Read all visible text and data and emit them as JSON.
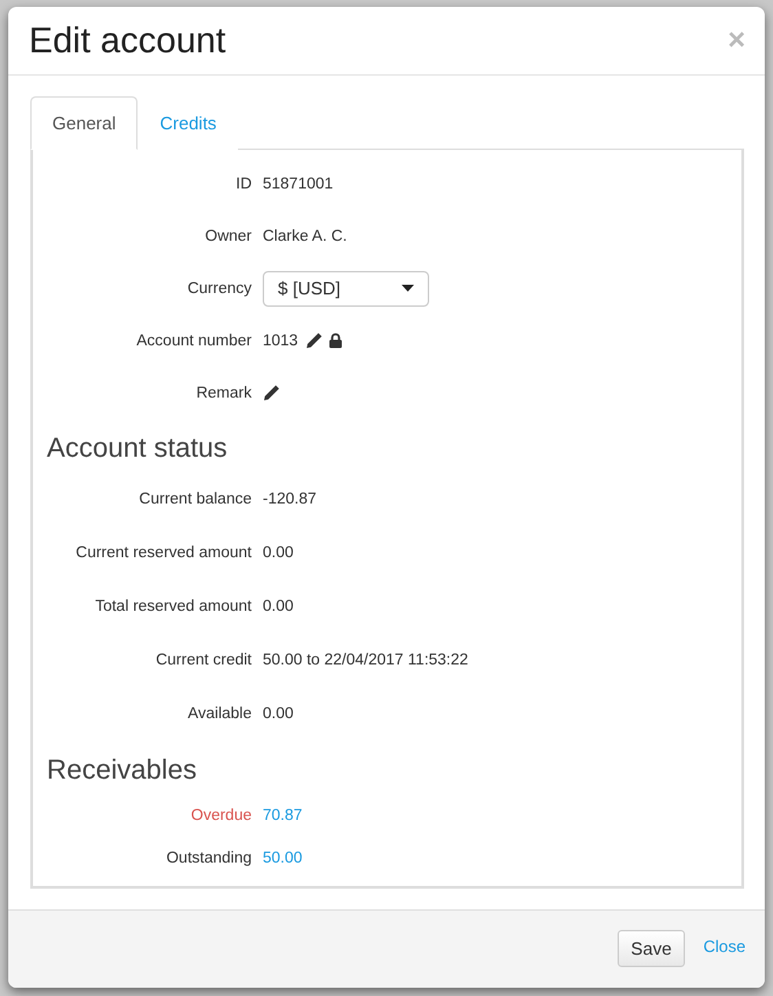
{
  "dialog": {
    "title": "Edit account",
    "close_glyph": "×"
  },
  "tabs": [
    {
      "label": "General",
      "selected": true
    },
    {
      "label": "Credits",
      "selected": false
    }
  ],
  "fields": [
    {
      "kind": "text",
      "label": "ID",
      "value": "51871001"
    },
    {
      "kind": "text",
      "label": "Owner",
      "value": "Clarke A. C."
    },
    {
      "kind": "select",
      "label": "Currency",
      "value": "$ [USD]"
    },
    {
      "kind": "locked",
      "label": "Account number",
      "value": "1013"
    },
    {
      "kind": "editable",
      "label": "Remark"
    }
  ],
  "account_status": {
    "heading": "Account status",
    "rows": [
      {
        "label": "Current balance",
        "value": "-120.87"
      },
      {
        "label": "Current reserved amount",
        "value": "0.00"
      },
      {
        "label": "Total reserved amount",
        "value": "0.00"
      },
      {
        "label": "Current credit",
        "value": "50.00 to 22/04/2017 11:53:22"
      },
      {
        "label": "Available",
        "value": "0.00"
      }
    ]
  },
  "receivables": {
    "heading": "Receivables",
    "rows": [
      {
        "label": "Overdue",
        "value": "70.87",
        "color": "#d9534f"
      },
      {
        "label": "Outstanding",
        "value": "50.00",
        "color": "#333333"
      }
    ]
  },
  "footer": {
    "save": "Save",
    "close": "Close"
  }
}
